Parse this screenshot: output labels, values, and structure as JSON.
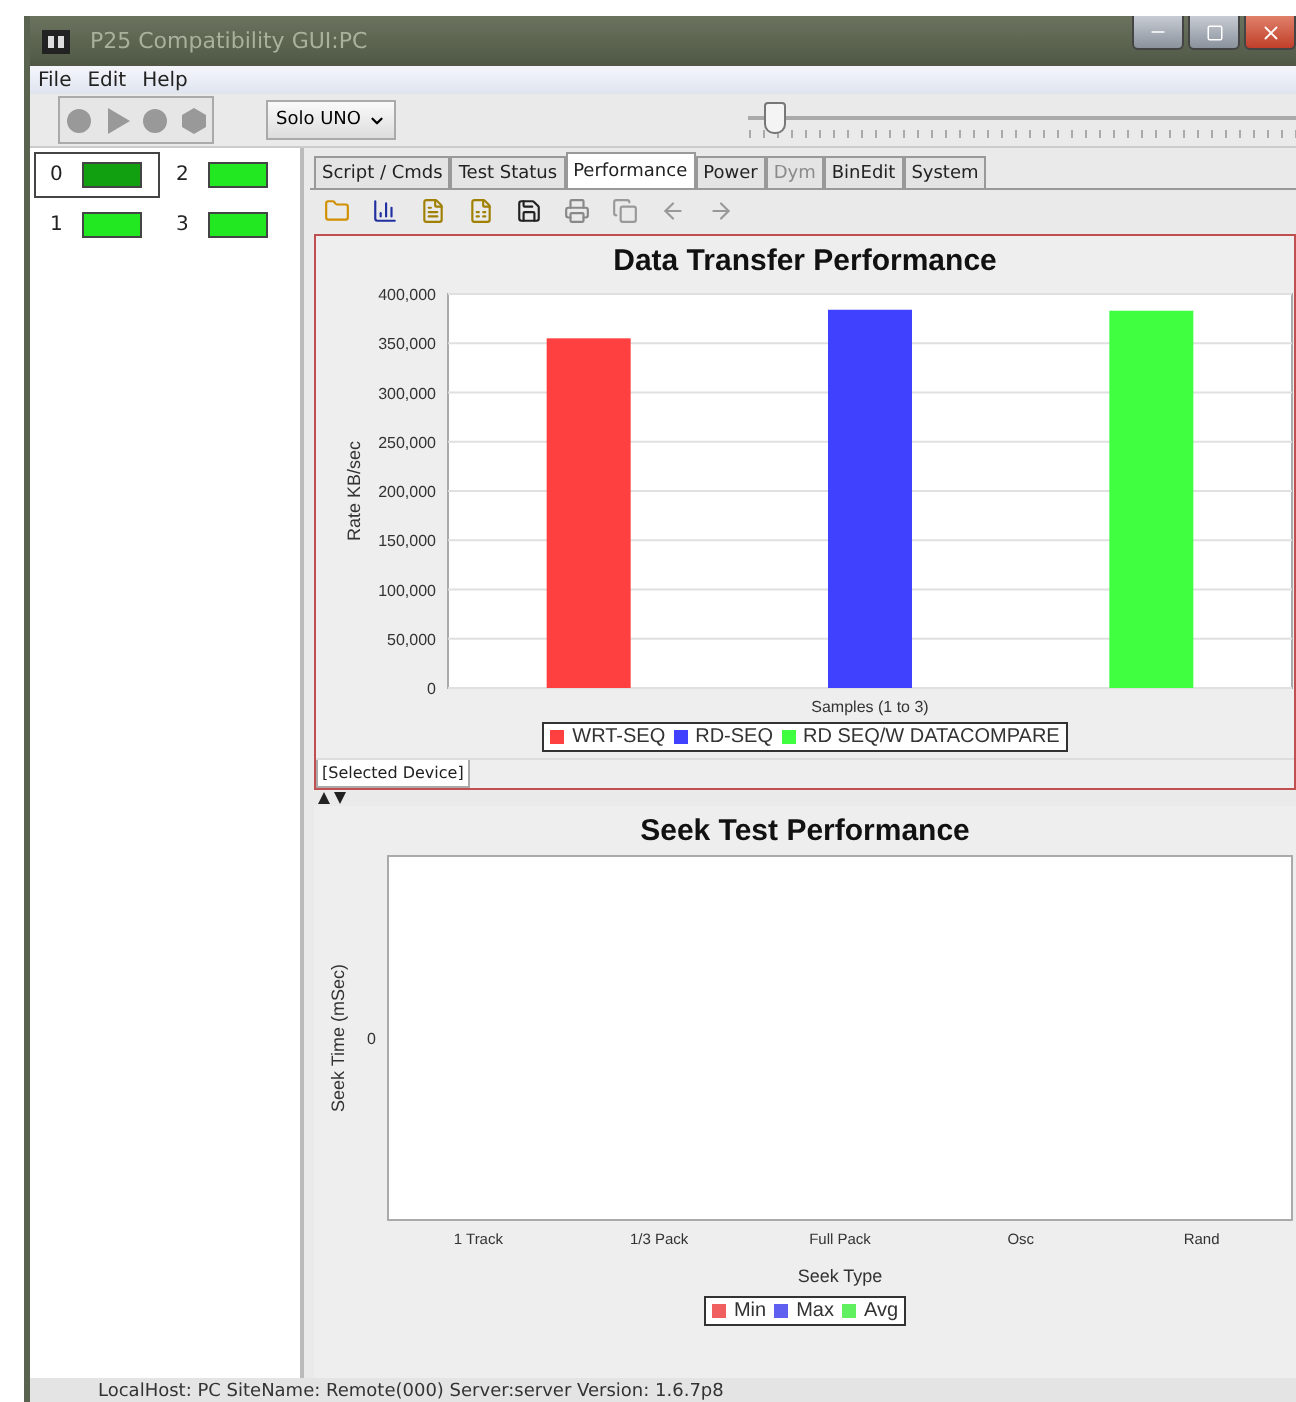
{
  "window": {
    "title": "P25 Compatibility GUI:PC"
  },
  "menu": [
    "File",
    "Edit",
    "Help"
  ],
  "toolbar": {
    "device_select": "Solo UNO",
    "slider": {
      "level": 0.05
    }
  },
  "devices": [
    {
      "label": "0",
      "selected": true
    },
    {
      "label": "2",
      "selected": false
    },
    {
      "label": "1",
      "selected": false
    },
    {
      "label": "3",
      "selected": false
    }
  ],
  "tabs": [
    {
      "label": "Script / Cmds",
      "selected": false,
      "disabled": false
    },
    {
      "label": "Test Status",
      "selected": false,
      "disabled": false
    },
    {
      "label": "Performance",
      "selected": true,
      "disabled": false
    },
    {
      "label": "Power",
      "selected": false,
      "disabled": false
    },
    {
      "label": "Dym",
      "selected": false,
      "disabled": true
    },
    {
      "label": "BinEdit",
      "selected": false,
      "disabled": false
    },
    {
      "label": "System",
      "selected": false,
      "disabled": false
    }
  ],
  "transfer_chart": {
    "chart_data": {
      "type": "bar",
      "title": "Data Transfer Performance",
      "xlabel": "Samples (1 to 3)",
      "ylabel": "Rate KB/sec",
      "grid": true,
      "ylim": [
        0,
        400000
      ],
      "yticks": [
        {
          "value": 0,
          "label": "0"
        },
        {
          "value": 50000,
          "label": "50,000"
        },
        {
          "value": 100000,
          "label": "100,000"
        },
        {
          "value": 150000,
          "label": "150,000"
        },
        {
          "value": 200000,
          "label": "200,000"
        },
        {
          "value": 250000,
          "label": "250,000"
        },
        {
          "value": 300000,
          "label": "300,000"
        },
        {
          "value": 350000,
          "label": "350,000"
        },
        {
          "value": 400000,
          "label": "400,000"
        }
      ],
      "series": [
        {
          "name": "WRT-SEQ",
          "color": "#ff4040",
          "values": [
            355000
          ]
        },
        {
          "name": "RD-SEQ",
          "color": "#4040ff",
          "values": [
            384000
          ]
        },
        {
          "name": "RD SEQ/W DATACOMPARE",
          "color": "#40ff40",
          "values": [
            383000
          ]
        }
      ]
    }
  },
  "selected_tab": "[Selected Device]",
  "seek_chart": {
    "title": "Seek Test Performance",
    "ylabel": "Seek Time (mSec)",
    "y_tick": "0",
    "categories": [
      "1 Track",
      "1/3 Pack",
      "Full Pack",
      "Osc",
      "Rand"
    ],
    "xlabel": "Seek Type",
    "series": [
      {
        "name": "Min",
        "color": "#f06060"
      },
      {
        "name": "Max",
        "color": "#6060f0"
      },
      {
        "name": "Avg",
        "color": "#60f060"
      }
    ]
  },
  "status_bar": "LocalHost: PC SiteName: Remote(000) Server:server Version: 1.6.7p8"
}
